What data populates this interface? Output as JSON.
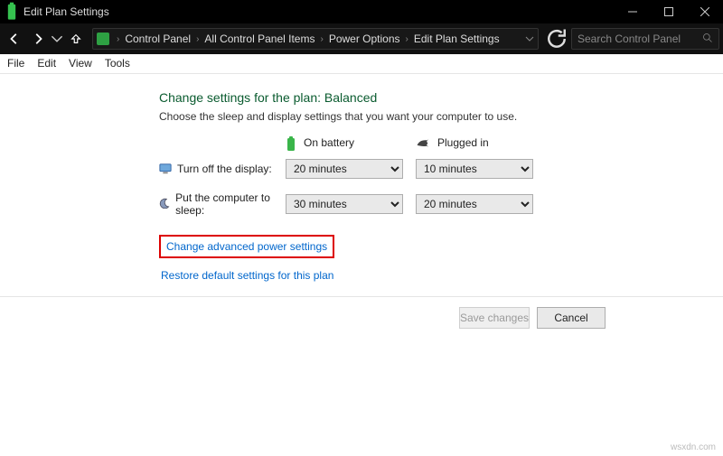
{
  "titlebar": {
    "title": "Edit Plan Settings"
  },
  "breadcrumb": {
    "items": [
      "Control Panel",
      "All Control Panel Items",
      "Power Options",
      "Edit Plan Settings"
    ]
  },
  "search": {
    "placeholder": "Search Control Panel"
  },
  "menubar": {
    "items": [
      "File",
      "Edit",
      "View",
      "Tools"
    ]
  },
  "page": {
    "heading": "Change settings for the plan: Balanced",
    "subtext": "Choose the sleep and display settings that you want your computer to use.",
    "col_battery": "On battery",
    "col_plugged": "Plugged in",
    "row_display": "Turn off the display:",
    "row_sleep": "Put the computer to sleep:",
    "display_battery": "20 minutes",
    "display_plugged": "10 minutes",
    "sleep_battery": "30 minutes",
    "sleep_plugged": "20 minutes",
    "link_advanced": "Change advanced power settings",
    "link_restore": "Restore default settings for this plan"
  },
  "footer": {
    "save": "Save changes",
    "cancel": "Cancel"
  },
  "watermark": "wsxdn.com"
}
